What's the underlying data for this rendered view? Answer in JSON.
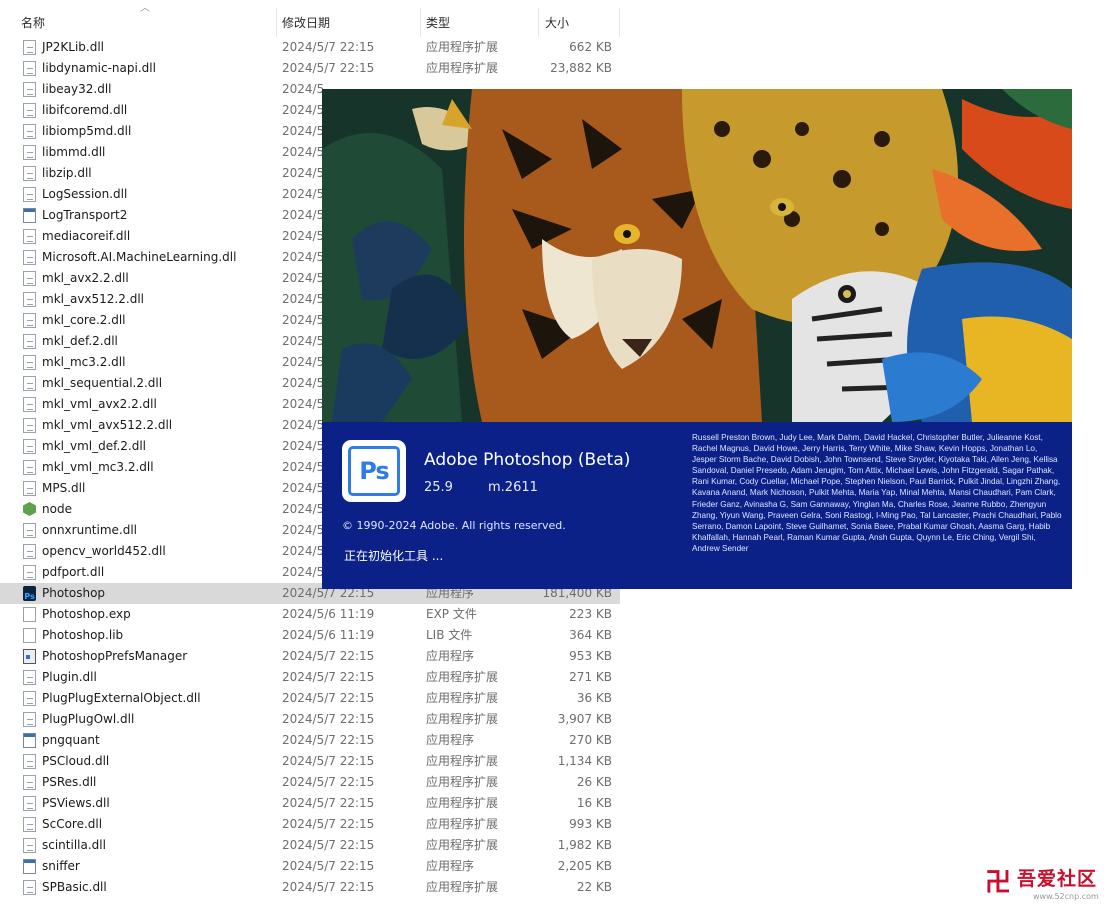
{
  "columns": {
    "name": "名称",
    "modified": "修改日期",
    "type": "类型",
    "size": "大小"
  },
  "files": [
    {
      "icon": "dll",
      "name": "JP2KLib.dll",
      "date": "2024/5/7 22:15",
      "type": "应用程序扩展",
      "size": "662 KB"
    },
    {
      "icon": "dll",
      "name": "libdynamic-napi.dll",
      "date": "2024/5/7 22:15",
      "type": "应用程序扩展",
      "size": "23,882 KB"
    },
    {
      "icon": "dll",
      "name": "libeay32.dll",
      "date": "2024/5",
      "type": "",
      "size": ""
    },
    {
      "icon": "dll",
      "name": "libifcoremd.dll",
      "date": "2024/5",
      "type": "",
      "size": ""
    },
    {
      "icon": "dll",
      "name": "libiomp5md.dll",
      "date": "2024/5",
      "type": "",
      "size": ""
    },
    {
      "icon": "dll",
      "name": "libmmd.dll",
      "date": "2024/5",
      "type": "",
      "size": ""
    },
    {
      "icon": "dll",
      "name": "libzip.dll",
      "date": "2024/5",
      "type": "",
      "size": ""
    },
    {
      "icon": "dll",
      "name": "LogSession.dll",
      "date": "2024/5",
      "type": "",
      "size": ""
    },
    {
      "icon": "exe",
      "name": "LogTransport2",
      "date": "2024/5",
      "type": "",
      "size": ""
    },
    {
      "icon": "dll",
      "name": "mediacoreif.dll",
      "date": "2024/5",
      "type": "",
      "size": ""
    },
    {
      "icon": "dll",
      "name": "Microsoft.AI.MachineLearning.dll",
      "date": "2024/5",
      "type": "",
      "size": ""
    },
    {
      "icon": "dll",
      "name": "mkl_avx2.2.dll",
      "date": "2024/5",
      "type": "",
      "size": ""
    },
    {
      "icon": "dll",
      "name": "mkl_avx512.2.dll",
      "date": "2024/5",
      "type": "",
      "size": ""
    },
    {
      "icon": "dll",
      "name": "mkl_core.2.dll",
      "date": "2024/5",
      "type": "",
      "size": ""
    },
    {
      "icon": "dll",
      "name": "mkl_def.2.dll",
      "date": "2024/5",
      "type": "",
      "size": ""
    },
    {
      "icon": "dll",
      "name": "mkl_mc3.2.dll",
      "date": "2024/5",
      "type": "",
      "size": ""
    },
    {
      "icon": "dll",
      "name": "mkl_sequential.2.dll",
      "date": "2024/5",
      "type": "",
      "size": ""
    },
    {
      "icon": "dll",
      "name": "mkl_vml_avx2.2.dll",
      "date": "2024/5",
      "type": "",
      "size": ""
    },
    {
      "icon": "dll",
      "name": "mkl_vml_avx512.2.dll",
      "date": "2024/5",
      "type": "",
      "size": ""
    },
    {
      "icon": "dll",
      "name": "mkl_vml_def.2.dll",
      "date": "2024/5",
      "type": "",
      "size": ""
    },
    {
      "icon": "dll",
      "name": "mkl_vml_mc3.2.dll",
      "date": "2024/5",
      "type": "",
      "size": ""
    },
    {
      "icon": "dll",
      "name": "MPS.dll",
      "date": "2024/5",
      "type": "",
      "size": ""
    },
    {
      "icon": "node",
      "name": "node",
      "date": "2024/5",
      "type": "",
      "size": ""
    },
    {
      "icon": "dll",
      "name": "onnxruntime.dll",
      "date": "2024/5",
      "type": "",
      "size": ""
    },
    {
      "icon": "dll",
      "name": "opencv_world452.dll",
      "date": "2024/5",
      "type": "",
      "size": ""
    },
    {
      "icon": "dll",
      "name": "pdfport.dll",
      "date": "2024/5",
      "type": "",
      "size": ""
    },
    {
      "icon": "ps",
      "name": "Photoshop",
      "date": "2024/5/7 22:15",
      "type": "应用程序",
      "size": "181,400 KB",
      "selected": true
    },
    {
      "icon": "file",
      "name": "Photoshop.exp",
      "date": "2024/5/6 11:19",
      "type": "EXP 文件",
      "size": "223 KB"
    },
    {
      "icon": "file",
      "name": "Photoshop.lib",
      "date": "2024/5/6 11:19",
      "type": "LIB 文件",
      "size": "364 KB"
    },
    {
      "icon": "prefs",
      "name": "PhotoshopPrefsManager",
      "date": "2024/5/7 22:15",
      "type": "应用程序",
      "size": "953 KB"
    },
    {
      "icon": "dll",
      "name": "Plugin.dll",
      "date": "2024/5/7 22:15",
      "type": "应用程序扩展",
      "size": "271 KB"
    },
    {
      "icon": "dll",
      "name": "PlugPlugExternalObject.dll",
      "date": "2024/5/7 22:15",
      "type": "应用程序扩展",
      "size": "36 KB"
    },
    {
      "icon": "dll",
      "name": "PlugPlugOwl.dll",
      "date": "2024/5/7 22:15",
      "type": "应用程序扩展",
      "size": "3,907 KB"
    },
    {
      "icon": "exe",
      "name": "pngquant",
      "date": "2024/5/7 22:15",
      "type": "应用程序",
      "size": "270 KB"
    },
    {
      "icon": "dll",
      "name": "PSCloud.dll",
      "date": "2024/5/7 22:15",
      "type": "应用程序扩展",
      "size": "1,134 KB"
    },
    {
      "icon": "dll",
      "name": "PSRes.dll",
      "date": "2024/5/7 22:15",
      "type": "应用程序扩展",
      "size": "26 KB"
    },
    {
      "icon": "dll",
      "name": "PSViews.dll",
      "date": "2024/5/7 22:15",
      "type": "应用程序扩展",
      "size": "16 KB"
    },
    {
      "icon": "dll",
      "name": "ScCore.dll",
      "date": "2024/5/7 22:15",
      "type": "应用程序扩展",
      "size": "993 KB"
    },
    {
      "icon": "dll",
      "name": "scintilla.dll",
      "date": "2024/5/7 22:15",
      "type": "应用程序扩展",
      "size": "1,982 KB"
    },
    {
      "icon": "exe",
      "name": "sniffer",
      "date": "2024/5/7 22:15",
      "type": "应用程序",
      "size": "2,205 KB"
    },
    {
      "icon": "dll",
      "name": "SPBasic.dll",
      "date": "2024/5/7 22:15",
      "type": "应用程序扩展",
      "size": "22 KB"
    }
  ],
  "splash": {
    "logo_text": "Ps",
    "app_name": "Adobe Photoshop (Beta)",
    "version": "25.9",
    "build": "m.2611",
    "copyright": "© 1990-2024 Adobe. All rights reserved.",
    "status": "正在初始化工具 ...",
    "credits": "Russell Preston Brown, Judy Lee, Mark Dahm, David Hackel, Christopher Butler, Julieanne Kost, Rachel Magnus, David Howe, Jerry Harris, Terry White, Mike Shaw, Kevin Hopps, Jonathan Lo, Jesper Storm Bache, David Dobish, John Townsend, Steve Snyder, Kiyotaka Taki, Allen Jeng, Kellisa Sandoval, Daniel Presedo, Adam Jerugim, Tom Attix, Michael Lewis, John Fitzgerald, Sagar Pathak, Rani Kumar, Cody Cuellar, Michael Pope, Stephen Nielson, Paul Barrick, Pulkit Jindal, Lingzhi Zhang, Kavana Anand, Mark Nichoson, Pulkit Mehta, Maria Yap, Minal Mehta, Mansi Chaudhari, Pam Clark, Frieder Ganz, Avinasha G, Sam Gannaway, Yinglan Ma, Charles Rose, Jeanne Rubbo, Zhengyun Zhang, Yiyun Wang, Praveen Gelra, Soni Rastogi, I-Ming Pao, Tal Lancaster, Prachi Chaudhari, Pablo Serrano, Damon Lapoint, Steve Guilhamet, Sonia Baee, Prabal Kumar Ghosh, Aasma Garg, Habib Khalfallah, Hannah Pearl, Raman Kumar Gupta, Ansh Gupta, Quynn Le, Eric Ching, Vergil Shi, Andrew Sender",
    "colors": {
      "info_bg": "#0b2188",
      "logo_blue": "#2f7bea"
    }
  },
  "watermark": {
    "glyph": "卍",
    "text": "吾爱社区",
    "url": "www.52cnp.com"
  }
}
